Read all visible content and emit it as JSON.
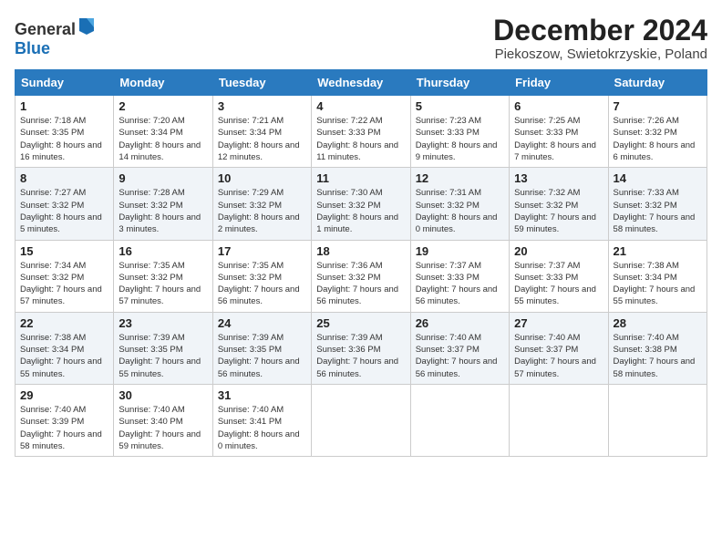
{
  "logo": {
    "text_general": "General",
    "text_blue": "Blue"
  },
  "title": "December 2024",
  "location": "Piekoszow, Swietokrzyskie, Poland",
  "days_of_week": [
    "Sunday",
    "Monday",
    "Tuesday",
    "Wednesday",
    "Thursday",
    "Friday",
    "Saturday"
  ],
  "weeks": [
    [
      {
        "day": "1",
        "info": "Sunrise: 7:18 AM\nSunset: 3:35 PM\nDaylight: 8 hours\nand 16 minutes."
      },
      {
        "day": "2",
        "info": "Sunrise: 7:20 AM\nSunset: 3:34 PM\nDaylight: 8 hours\nand 14 minutes."
      },
      {
        "day": "3",
        "info": "Sunrise: 7:21 AM\nSunset: 3:34 PM\nDaylight: 8 hours\nand 12 minutes."
      },
      {
        "day": "4",
        "info": "Sunrise: 7:22 AM\nSunset: 3:33 PM\nDaylight: 8 hours\nand 11 minutes."
      },
      {
        "day": "5",
        "info": "Sunrise: 7:23 AM\nSunset: 3:33 PM\nDaylight: 8 hours\nand 9 minutes."
      },
      {
        "day": "6",
        "info": "Sunrise: 7:25 AM\nSunset: 3:33 PM\nDaylight: 8 hours\nand 7 minutes."
      },
      {
        "day": "7",
        "info": "Sunrise: 7:26 AM\nSunset: 3:32 PM\nDaylight: 8 hours\nand 6 minutes."
      }
    ],
    [
      {
        "day": "8",
        "info": "Sunrise: 7:27 AM\nSunset: 3:32 PM\nDaylight: 8 hours\nand 5 minutes."
      },
      {
        "day": "9",
        "info": "Sunrise: 7:28 AM\nSunset: 3:32 PM\nDaylight: 8 hours\nand 3 minutes."
      },
      {
        "day": "10",
        "info": "Sunrise: 7:29 AM\nSunset: 3:32 PM\nDaylight: 8 hours\nand 2 minutes."
      },
      {
        "day": "11",
        "info": "Sunrise: 7:30 AM\nSunset: 3:32 PM\nDaylight: 8 hours\nand 1 minute."
      },
      {
        "day": "12",
        "info": "Sunrise: 7:31 AM\nSunset: 3:32 PM\nDaylight: 8 hours\nand 0 minutes."
      },
      {
        "day": "13",
        "info": "Sunrise: 7:32 AM\nSunset: 3:32 PM\nDaylight: 7 hours\nand 59 minutes."
      },
      {
        "day": "14",
        "info": "Sunrise: 7:33 AM\nSunset: 3:32 PM\nDaylight: 7 hours\nand 58 minutes."
      }
    ],
    [
      {
        "day": "15",
        "info": "Sunrise: 7:34 AM\nSunset: 3:32 PM\nDaylight: 7 hours\nand 57 minutes."
      },
      {
        "day": "16",
        "info": "Sunrise: 7:35 AM\nSunset: 3:32 PM\nDaylight: 7 hours\nand 57 minutes."
      },
      {
        "day": "17",
        "info": "Sunrise: 7:35 AM\nSunset: 3:32 PM\nDaylight: 7 hours\nand 56 minutes."
      },
      {
        "day": "18",
        "info": "Sunrise: 7:36 AM\nSunset: 3:32 PM\nDaylight: 7 hours\nand 56 minutes."
      },
      {
        "day": "19",
        "info": "Sunrise: 7:37 AM\nSunset: 3:33 PM\nDaylight: 7 hours\nand 56 minutes."
      },
      {
        "day": "20",
        "info": "Sunrise: 7:37 AM\nSunset: 3:33 PM\nDaylight: 7 hours\nand 55 minutes."
      },
      {
        "day": "21",
        "info": "Sunrise: 7:38 AM\nSunset: 3:34 PM\nDaylight: 7 hours\nand 55 minutes."
      }
    ],
    [
      {
        "day": "22",
        "info": "Sunrise: 7:38 AM\nSunset: 3:34 PM\nDaylight: 7 hours\nand 55 minutes."
      },
      {
        "day": "23",
        "info": "Sunrise: 7:39 AM\nSunset: 3:35 PM\nDaylight: 7 hours\nand 55 minutes."
      },
      {
        "day": "24",
        "info": "Sunrise: 7:39 AM\nSunset: 3:35 PM\nDaylight: 7 hours\nand 56 minutes."
      },
      {
        "day": "25",
        "info": "Sunrise: 7:39 AM\nSunset: 3:36 PM\nDaylight: 7 hours\nand 56 minutes."
      },
      {
        "day": "26",
        "info": "Sunrise: 7:40 AM\nSunset: 3:37 PM\nDaylight: 7 hours\nand 56 minutes."
      },
      {
        "day": "27",
        "info": "Sunrise: 7:40 AM\nSunset: 3:37 PM\nDaylight: 7 hours\nand 57 minutes."
      },
      {
        "day": "28",
        "info": "Sunrise: 7:40 AM\nSunset: 3:38 PM\nDaylight: 7 hours\nand 58 minutes."
      }
    ],
    [
      {
        "day": "29",
        "info": "Sunrise: 7:40 AM\nSunset: 3:39 PM\nDaylight: 7 hours\nand 58 minutes."
      },
      {
        "day": "30",
        "info": "Sunrise: 7:40 AM\nSunset: 3:40 PM\nDaylight: 7 hours\nand 59 minutes."
      },
      {
        "day": "31",
        "info": "Sunrise: 7:40 AM\nSunset: 3:41 PM\nDaylight: 8 hours\nand 0 minutes."
      },
      null,
      null,
      null,
      null
    ]
  ]
}
